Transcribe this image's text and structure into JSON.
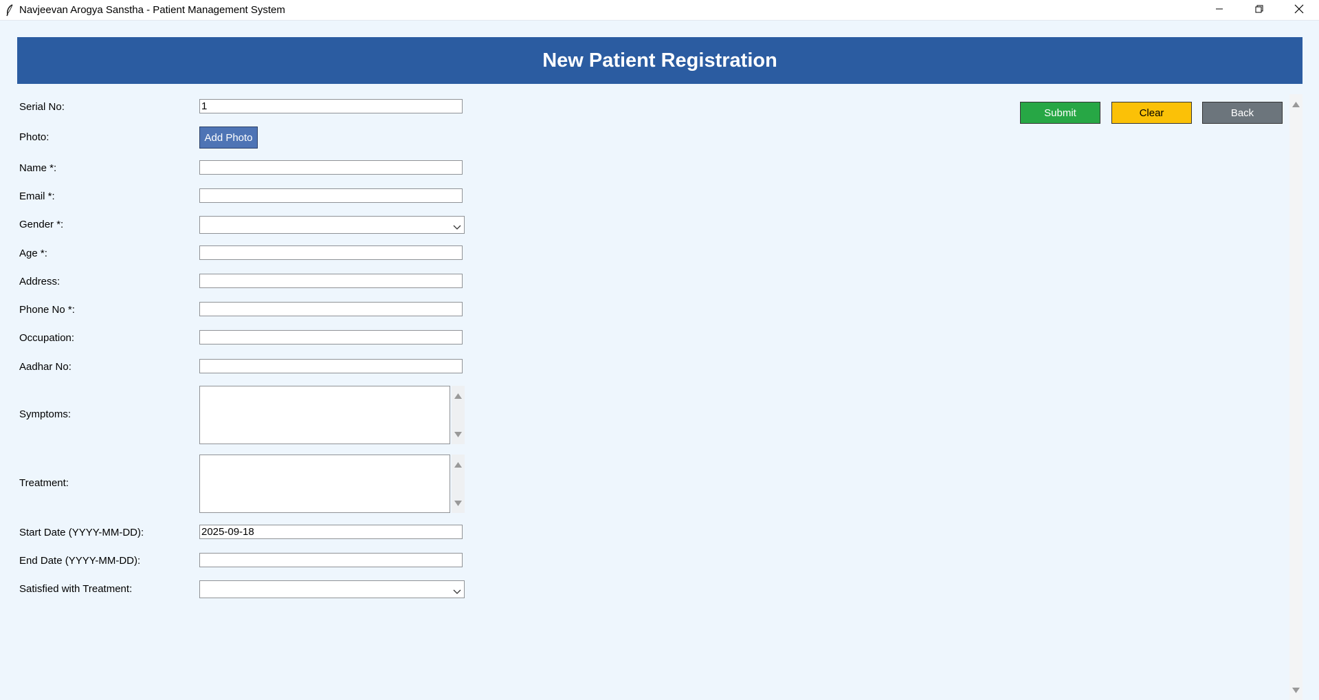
{
  "window": {
    "title": "Navjeevan Arogya Sanstha - Patient Management System"
  },
  "header": {
    "title": "New Patient Registration"
  },
  "form": {
    "serial_no": {
      "label": "Serial No:",
      "value": "1"
    },
    "photo": {
      "label": "Photo:",
      "button": "Add Photo"
    },
    "name": {
      "label": "Name *:",
      "value": ""
    },
    "email": {
      "label": "Email *:",
      "value": ""
    },
    "gender": {
      "label": "Gender *:",
      "value": ""
    },
    "age": {
      "label": "Age *:",
      "value": ""
    },
    "address": {
      "label": "Address:",
      "value": ""
    },
    "phone": {
      "label": "Phone No *:",
      "value": ""
    },
    "occupation": {
      "label": "Occupation:",
      "value": ""
    },
    "aadhar": {
      "label": "Aadhar No:",
      "value": ""
    },
    "symptoms": {
      "label": "Symptoms:",
      "value": ""
    },
    "treatment": {
      "label": "Treatment:",
      "value": ""
    },
    "start_date": {
      "label": "Start Date (YYYY-MM-DD):",
      "value": "2025-09-18"
    },
    "end_date": {
      "label": "End Date (YYYY-MM-DD):",
      "value": ""
    },
    "satisfied": {
      "label": "Satisfied with Treatment:",
      "value": ""
    }
  },
  "actions": {
    "submit": "Submit",
    "clear": "Clear",
    "back": "Back"
  },
  "colors": {
    "header_bg": "#2b5ca1",
    "page_bg": "#eef6fd",
    "submit": "#27a745",
    "clear": "#fbc107",
    "back": "#6c757c",
    "add_photo": "#4e74b5"
  },
  "icons": {
    "app": "feather-icon",
    "minimize": "minimize-icon",
    "restore": "restore-icon",
    "close": "close-icon",
    "dropdown": "chevron-down-icon",
    "scroll_up": "scroll-up-arrow-icon",
    "scroll_down": "scroll-down-arrow-icon"
  }
}
